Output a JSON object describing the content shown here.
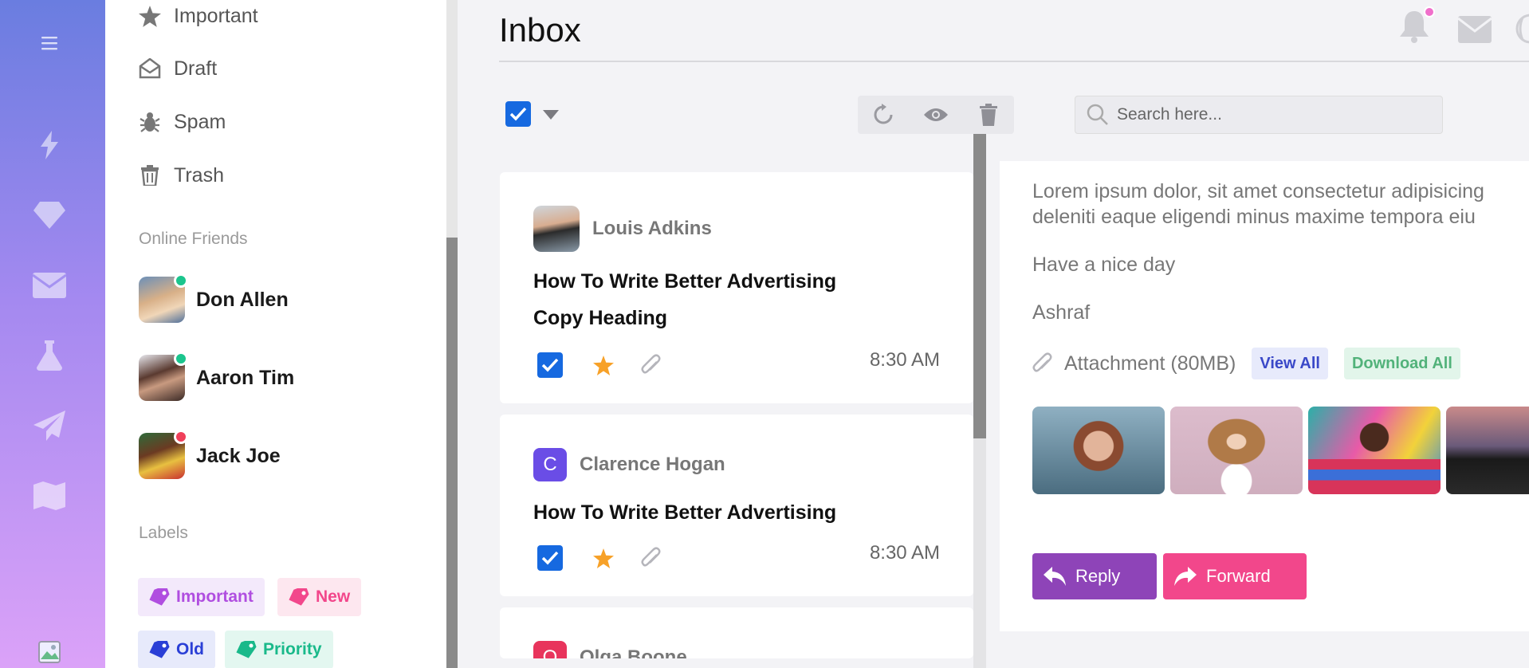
{
  "rail": {
    "icons": [
      "menu-icon",
      "bolt-icon",
      "diamond-icon",
      "envelope-icon",
      "flask-icon",
      "paper-plane-icon",
      "map-icon",
      "broken-image-icon"
    ],
    "gradient": [
      "#6a7de0",
      "#dba2f8"
    ]
  },
  "folders": [
    {
      "label": "Important",
      "icon": "star-icon"
    },
    {
      "label": "Draft",
      "icon": "open-envelope-icon"
    },
    {
      "label": "Spam",
      "icon": "bug-icon"
    },
    {
      "label": "Trash",
      "icon": "trash-icon"
    }
  ],
  "friends": {
    "title": "Online Friends",
    "items": [
      {
        "name": "Don Allen",
        "status_color": "#1bc58d"
      },
      {
        "name": "Aaron Tim",
        "status_color": "#1bc58d"
      },
      {
        "name": "Jack Joe",
        "status_color": "#f0405a"
      }
    ]
  },
  "labels": {
    "title": "Labels",
    "items": [
      {
        "label": "Important",
        "color": "#b04ee0",
        "bg": "#f3e9fb"
      },
      {
        "label": "New",
        "color": "#f2478b",
        "bg": "#fde7ef"
      },
      {
        "label": "Old",
        "color": "#2a3fd6",
        "bg": "#e7eafb"
      },
      {
        "label": "Priority",
        "color": "#19b98a",
        "bg": "#e3f7f0"
      }
    ]
  },
  "header": {
    "title": "Inbox",
    "icons": [
      "bell-icon",
      "envelope-icon",
      "globe-icon"
    ],
    "notification_dot_color": "#f06fcb"
  },
  "toolbar": {
    "tools": [
      "refresh-icon",
      "eye-icon",
      "trash-icon"
    ],
    "search_placeholder": "Search here..."
  },
  "mails": [
    {
      "sender": "Louis Adkins",
      "subject_line1": "How To Write Better Advertising",
      "subject_line2": "Copy Heading",
      "time": "8:30 AM",
      "starred": true
    },
    {
      "sender": "Clarence Hogan",
      "avatar_letter": "C",
      "avatar_color": "#6a4de6",
      "subject_line1": "How To Write Better Advertising",
      "time": "8:30 AM",
      "starred": true
    },
    {
      "sender": "Olga Boone",
      "avatar_letter": "O",
      "avatar_color": "#e8345c"
    }
  ],
  "reader": {
    "line1": "Lorem ipsum dolor, sit amet consectetur adipisicing",
    "line2": "deleniti eaque eligendi minus maxime tempora eiu",
    "greeting": "Have a nice day",
    "signature": "Ashraf",
    "attachment_text": "Attachment (80MB)",
    "view_all": "View All",
    "download_all": "Download All",
    "reply": "Reply",
    "forward": "Forward"
  }
}
